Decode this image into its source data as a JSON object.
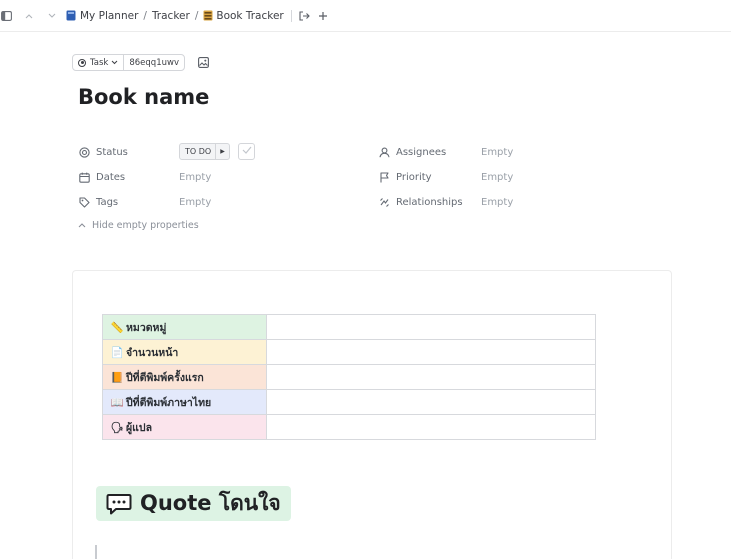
{
  "breadcrumb": {
    "workspace": "My Planner",
    "folder": "Tracker",
    "list": "Book Tracker",
    "separator": "/"
  },
  "task_chip": {
    "type": "Task",
    "id": "86eqq1uwv"
  },
  "title": "Book name",
  "properties": {
    "status": {
      "label": "Status",
      "value": "TO DO"
    },
    "dates": {
      "label": "Dates",
      "value": "Empty"
    },
    "tags": {
      "label": "Tags",
      "value": "Empty"
    },
    "assignees": {
      "label": "Assignees",
      "value": "Empty"
    },
    "priority": {
      "label": "Priority",
      "value": "Empty"
    },
    "relationships": {
      "label": "Relationships",
      "value": "Empty"
    }
  },
  "hide_empty_label": "Hide empty properties",
  "info_table": {
    "rows": [
      {
        "emoji": "📏",
        "label": "หมวดหมู่",
        "color": "#def3e2",
        "value": ""
      },
      {
        "emoji": "📄",
        "label": "จำนวนหน้า",
        "color": "#fdf2d4",
        "value": ""
      },
      {
        "emoji": "📙",
        "label": "ปีที่ตีพิมพ์ครั้งแรก",
        "color": "#fbe4d7",
        "value": ""
      },
      {
        "emoji": "📖",
        "label": "ปีที่ตีพิมพ์ภาษาไทย",
        "color": "#e3e9fb",
        "value": ""
      },
      {
        "emoji": "🗣",
        "label": "ผู้แปล",
        "color": "#fbe4ec",
        "value": ""
      }
    ]
  },
  "quote_heading": "Quote โดนใจ",
  "colors": {
    "quote_bg": "#ddf3e4",
    "book_icon": "#2f5fb3"
  }
}
